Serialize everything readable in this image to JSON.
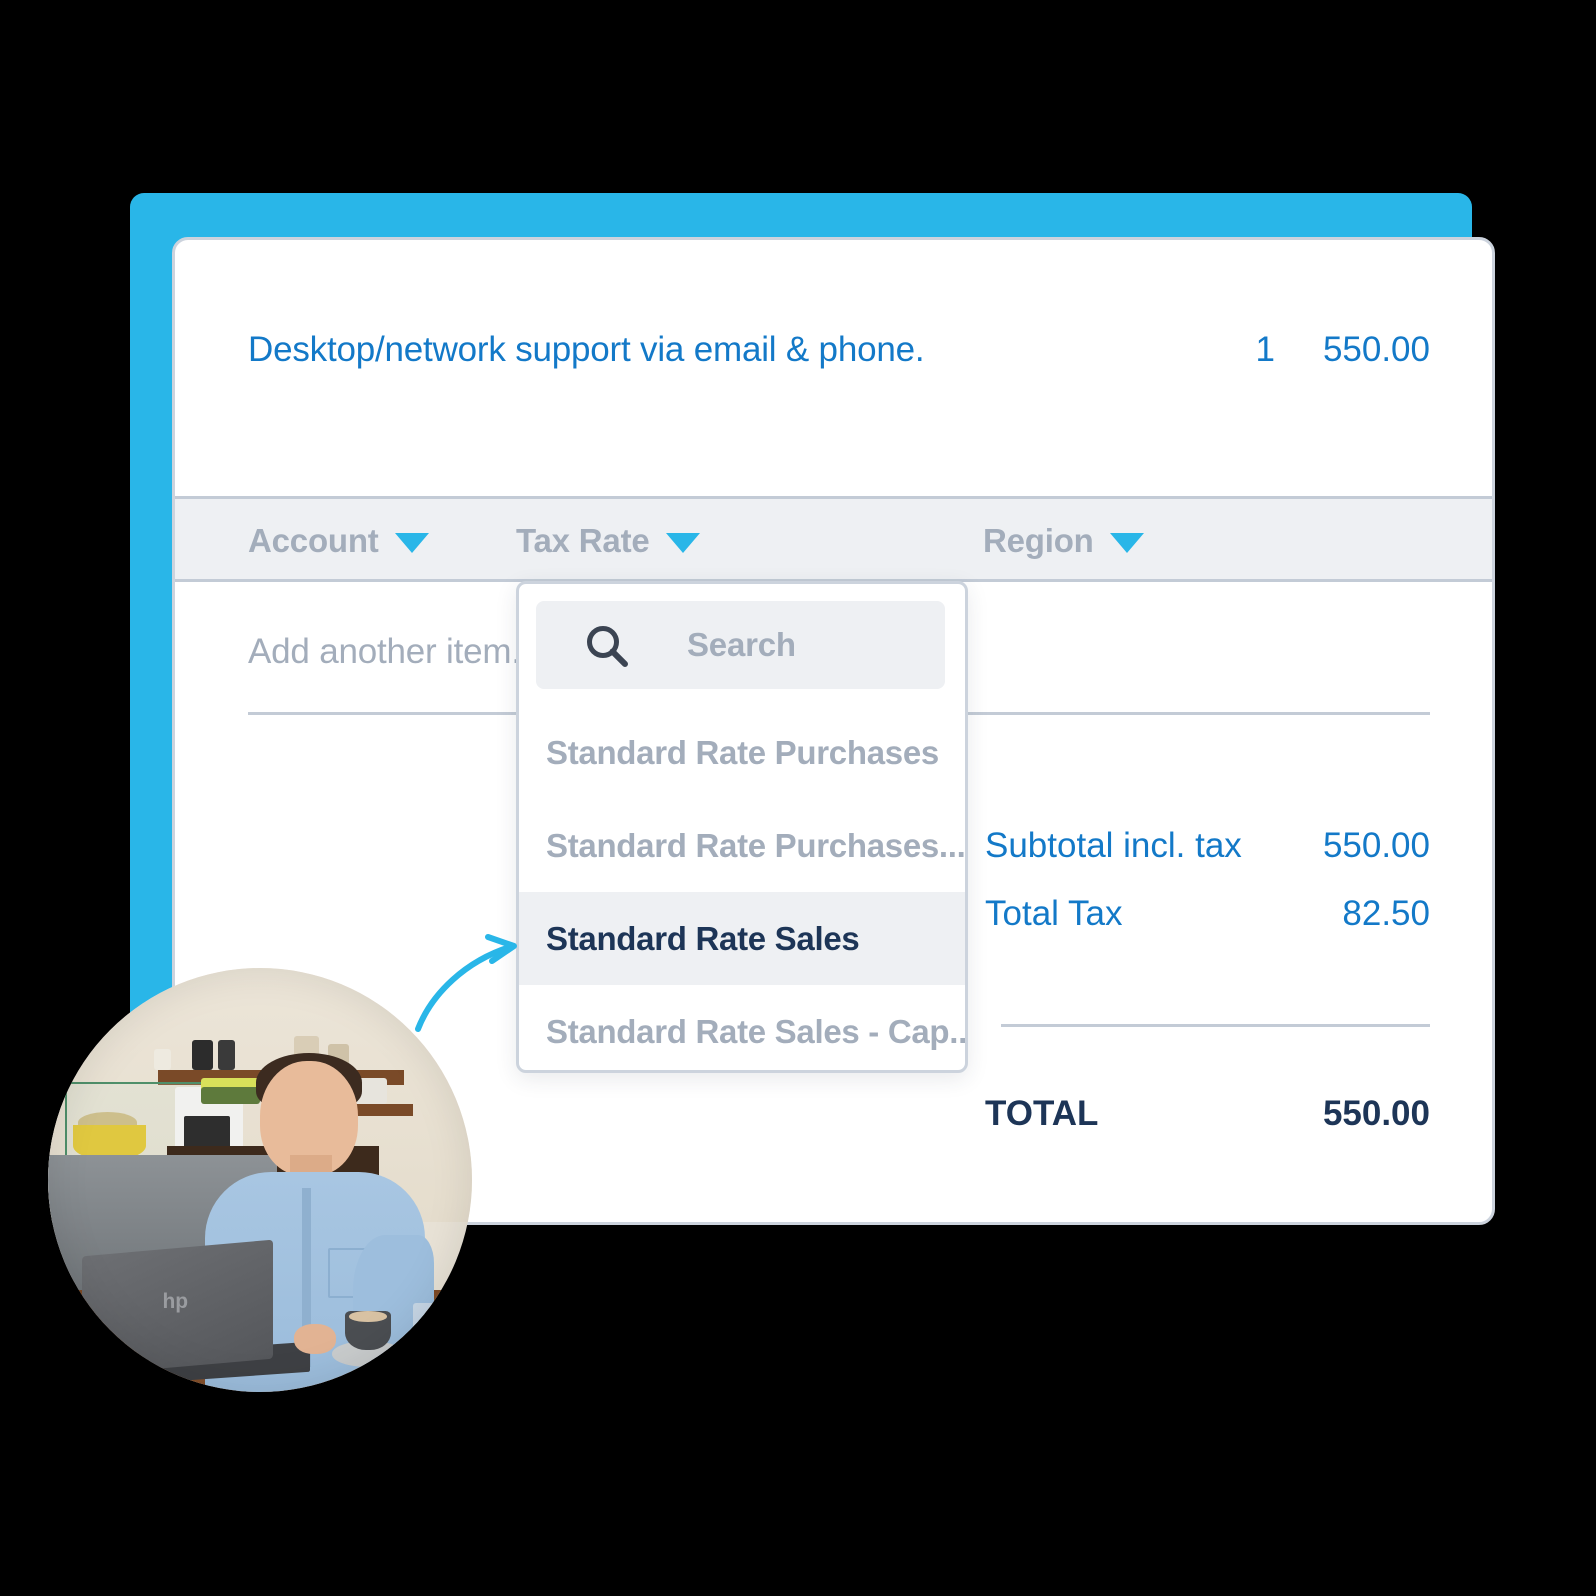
{
  "theme": {
    "accent_blue": "#29b6e8",
    "link_blue": "#1379c8",
    "muted_grey": "#a3adbb",
    "dark_navy": "#1d3557",
    "panel_grey": "#eef0f3",
    "border_grey": "#c3cbd6"
  },
  "line_item": {
    "description": "Desktop/network support via email & phone.",
    "quantity": "1",
    "amount": "550.00"
  },
  "columns": [
    {
      "id": "account",
      "label": "Account",
      "icon": "chevron-down-icon"
    },
    {
      "id": "tax_rate",
      "label": "Tax Rate",
      "icon": "chevron-down-icon"
    },
    {
      "id": "region",
      "label": "Region",
      "icon": "chevron-down-icon"
    }
  ],
  "add_item": {
    "placeholder": "Add another item..."
  },
  "tax_rate_dropdown": {
    "search": {
      "icon": "search-icon",
      "placeholder": "Search",
      "value": ""
    },
    "options": [
      {
        "label": "Standard Rate Purchases",
        "selected": false
      },
      {
        "label": "Standard Rate Purchases...",
        "selected": false
      },
      {
        "label": "Standard Rate Sales",
        "selected": true
      },
      {
        "label": "Standard Rate Sales - Cap..",
        "selected": false
      }
    ]
  },
  "totals": {
    "subtotal_label": "Subtotal incl. tax",
    "subtotal_value": "550.00",
    "tax_label": "Total Tax",
    "tax_value": "82.50",
    "grand_label": "TOTAL",
    "grand_value": "550.00"
  },
  "annotation": {
    "arrow": "curved-arrow-icon",
    "photo": "person-using-laptop-in-cafe-photo",
    "laptop_brand": "hp"
  }
}
